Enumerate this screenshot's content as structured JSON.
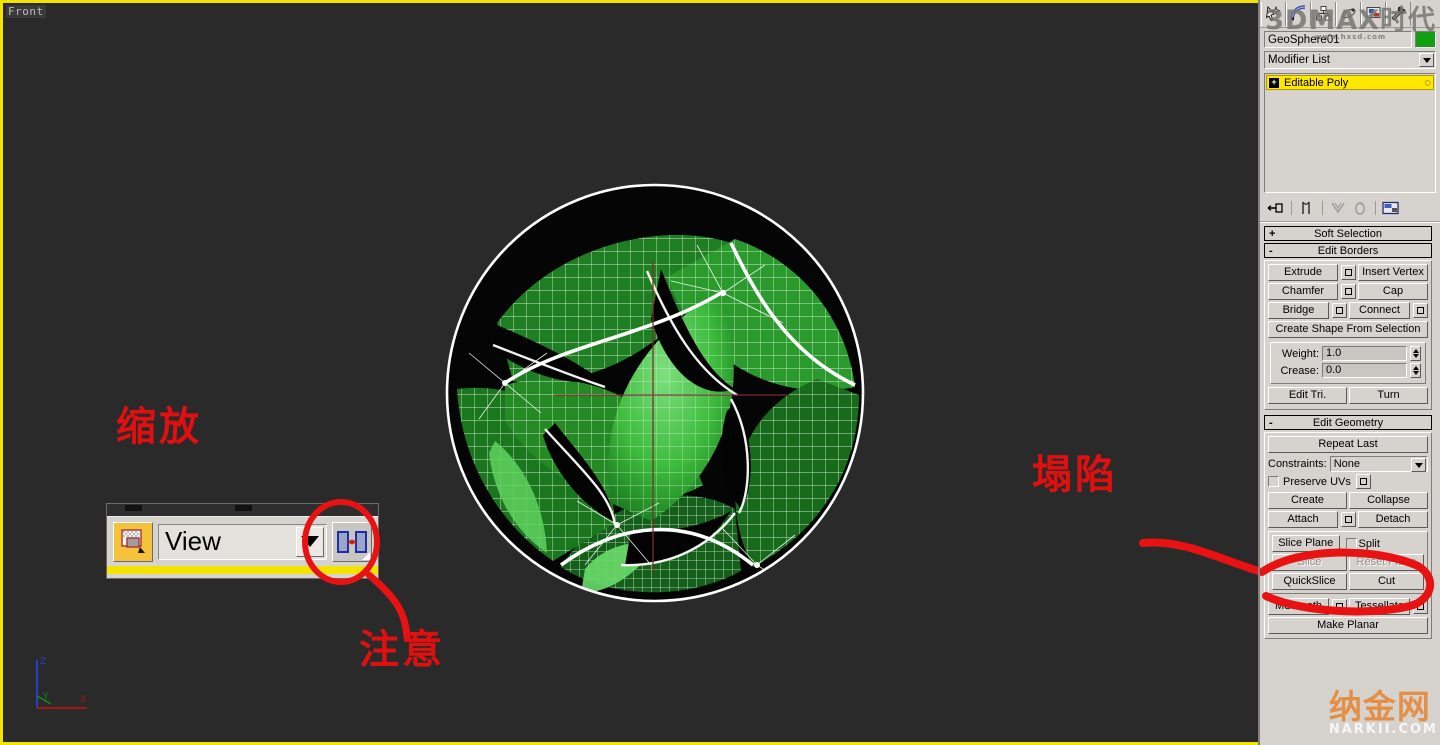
{
  "viewport": {
    "label": "Front",
    "axis": {
      "x": "X",
      "y": "Y",
      "z": "Z"
    },
    "object_name": "GeoSphere01"
  },
  "command_panel": {
    "tabs": [
      {
        "name": "create-tab",
        "icon": "arrow-star-icon"
      },
      {
        "name": "modify-tab",
        "icon": "curve-icon"
      },
      {
        "name": "hierarchy-tab",
        "icon": "hierarchy-icon"
      },
      {
        "name": "motion-tab",
        "icon": "motion-icon"
      },
      {
        "name": "display-tab",
        "icon": "display-icon"
      },
      {
        "name": "utilities-tab",
        "icon": "hammer-icon"
      }
    ],
    "object_name": "GeoSphere01",
    "object_color": "#12a012",
    "modifier_list_label": "Modifier List",
    "stack": [
      {
        "label": "Editable Poly",
        "expanded": false,
        "selected": true
      }
    ],
    "stack_tools": [
      "pin-stack-icon",
      "show-end-result-icon",
      "make-unique-icon",
      "remove-modifier-icon",
      "configure-modifier-sets-icon"
    ],
    "rollouts": [
      {
        "name": "soft-selection",
        "sign": "+",
        "title": "Soft Selection",
        "open": false
      },
      {
        "name": "edit-borders",
        "sign": "-",
        "title": "Edit Borders",
        "open": true
      },
      {
        "name": "edit-geometry",
        "sign": "-",
        "title": "Edit Geometry",
        "open": true
      }
    ],
    "edit_borders": {
      "rows": [
        {
          "left": "Extrude",
          "left_settings": true,
          "right": "Insert Vertex",
          "right_settings": false
        },
        {
          "left": "Chamfer",
          "left_settings": true,
          "right": "Cap",
          "right_settings": false
        },
        {
          "left": "Bridge",
          "left_settings": true,
          "right": "Connect",
          "right_settings": true
        }
      ],
      "full_button": "Create Shape From Selection",
      "weight_label": "Weight:",
      "weight_value": "1.0",
      "crease_label": "Crease:",
      "crease_value": "0.0",
      "edit_tri_label": "Edit Tri.",
      "turn_label": "Turn"
    },
    "edit_geometry": {
      "repeat_last": "Repeat Last",
      "constraints_label": "Constraints:",
      "constraints_value": "None",
      "preserve_uvs_label": "Preserve UVs",
      "rows": [
        {
          "left": "Create",
          "right": "Collapse",
          "left_settings": false,
          "right_settings": false
        },
        {
          "left": "Attach",
          "right": "Detach",
          "left_settings": true,
          "right_settings": false
        }
      ],
      "slice_plane": "Slice Plane",
      "split_label": "Split",
      "slice": "Slice",
      "reset_plane": "Reset Plane",
      "quickslice": "QuickSlice",
      "cut": "Cut",
      "msmooth": "MSmooth",
      "tessellate": "Tessellate",
      "make_planar": "Make Planar"
    }
  },
  "inset": {
    "coordinate_system_value": "View",
    "icon_left": "select-and-uniform-scale-icon",
    "icon_right": "use-pivot-point-center-icon"
  },
  "annotations": [
    {
      "name": "annotation-zoom",
      "text": "缩放"
    },
    {
      "name": "annotation-note",
      "text": "注意"
    },
    {
      "name": "annotation-collapse",
      "text": "塌陷"
    }
  ],
  "annotation_texts": {
    "zoom": "缩放",
    "note": "注意",
    "collapse": "塌陷"
  },
  "watermark": {
    "top": "3DMAX时代",
    "top_sub": "www.hxsd.com",
    "bottom": "纳金网",
    "bottom_sub": "NARKII.COM"
  },
  "colors": {
    "viewport_bg": "#2a2a2a",
    "active_border": "#f2e300",
    "panel_bg": "#d6d3ce",
    "stack_highlight": "#ffe800",
    "annotation_red": "#e01010",
    "mesh_green": "#1d8a1d"
  }
}
